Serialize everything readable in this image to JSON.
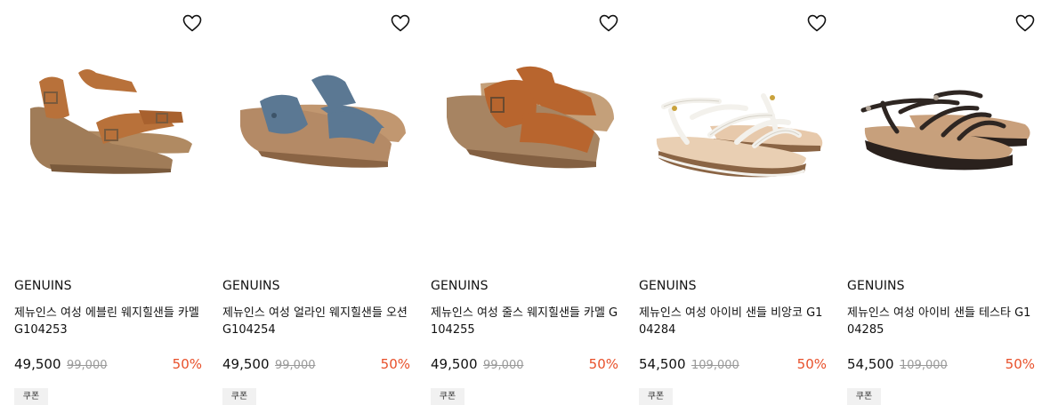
{
  "colors": {
    "discount": "#e8502a",
    "original_price": "#9a9a9a",
    "coupon_bg": "#f1f1f1"
  },
  "products": [
    {
      "brand": "GENUINS",
      "name": "제뉴인스 여성 에블린 웨지힐샌들 카멜 G104253",
      "price": "49,500",
      "original_price": "99,000",
      "discount": "50%",
      "coupon": "쿠폰",
      "wishlist_icon": "heart-outline-icon",
      "image_color": "#b8713a"
    },
    {
      "brand": "GENUINS",
      "name": "제뉴인스 여성 얼라인 웨지힐샌들 오션 G104254",
      "price": "49,500",
      "original_price": "99,000",
      "discount": "50%",
      "coupon": "쿠폰",
      "wishlist_icon": "heart-outline-icon",
      "image_color": "#5b7893"
    },
    {
      "brand": "GENUINS",
      "name": "제뉴인스 여성 줄스 웨지힐샌들 카멜 G104255",
      "price": "49,500",
      "original_price": "99,000",
      "discount": "50%",
      "coupon": "쿠폰",
      "wishlist_icon": "heart-outline-icon",
      "image_color": "#b8652e"
    },
    {
      "brand": "GENUINS",
      "name": "제뉴인스 여성 아이비 샌들 비앙코 G104284",
      "price": "54,500",
      "original_price": "109,000",
      "discount": "50%",
      "coupon": "쿠폰",
      "wishlist_icon": "heart-outline-icon",
      "image_color": "#f3f1ec"
    },
    {
      "brand": "GENUINS",
      "name": "제뉴인스 여성 아이비 샌들 테스타 G104285",
      "price": "54,500",
      "original_price": "109,000",
      "discount": "50%",
      "coupon": "쿠폰",
      "wishlist_icon": "heart-outline-icon",
      "image_color": "#2e2622"
    }
  ]
}
